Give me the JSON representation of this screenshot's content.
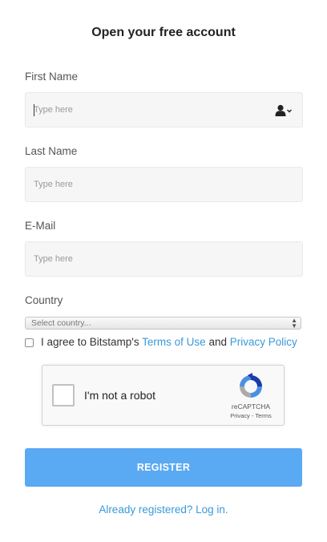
{
  "page_title": "Open your free account",
  "fields": [
    {
      "label": "First Name",
      "placeholder": "Type here"
    },
    {
      "label": "Last Name",
      "placeholder": "Type here"
    },
    {
      "label": "E-Mail",
      "placeholder": "Type here"
    }
  ],
  "country": {
    "label": "Country",
    "selected": "Select country..."
  },
  "agree": {
    "prefix": "I agree to Bitstamp's",
    "terms_link": "Terms of Use",
    "and": "and",
    "privacy_link": "Privacy Policy"
  },
  "captcha": {
    "label": "I'm not a robot",
    "brand": "reCAPTCHA",
    "links": "Privacy - Terms"
  },
  "register_label": "REGISTER",
  "login_link": "Already registered? Log in.",
  "colors": {
    "accent": "#5aa9f3",
    "link": "#3a9ad9"
  }
}
